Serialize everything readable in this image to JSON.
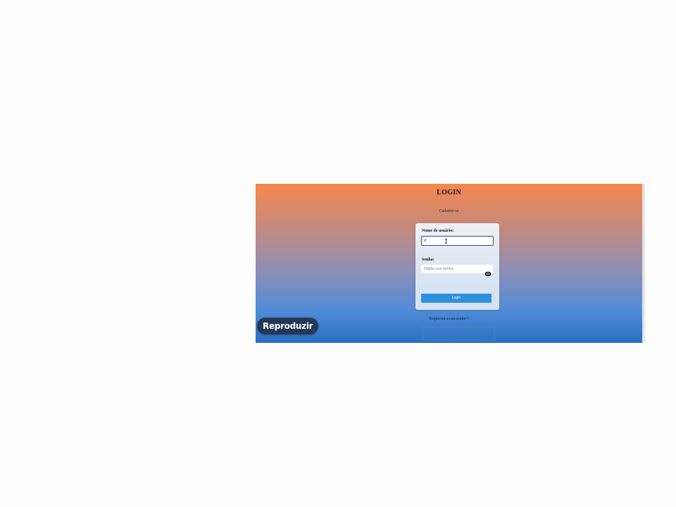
{
  "login_page": {
    "title": "LOGIN",
    "signup_link": "Cadastre-se",
    "form": {
      "username_label": "Nome de usuário:",
      "username_value": "d",
      "password_label": "Senha:",
      "password_placeholder": "Digite sua senha",
      "password_toggle_icon": "eye-icon",
      "login_button": "Login"
    },
    "forgot_password_link": "Esqueceu a sua senha ?"
  },
  "player": {
    "play_label": "Reproduzir"
  },
  "colors": {
    "gradient_top": "#f5874f",
    "gradient_bottom": "#2a6fc0",
    "login_button": "#2e8fde",
    "play_button": "#233756"
  }
}
